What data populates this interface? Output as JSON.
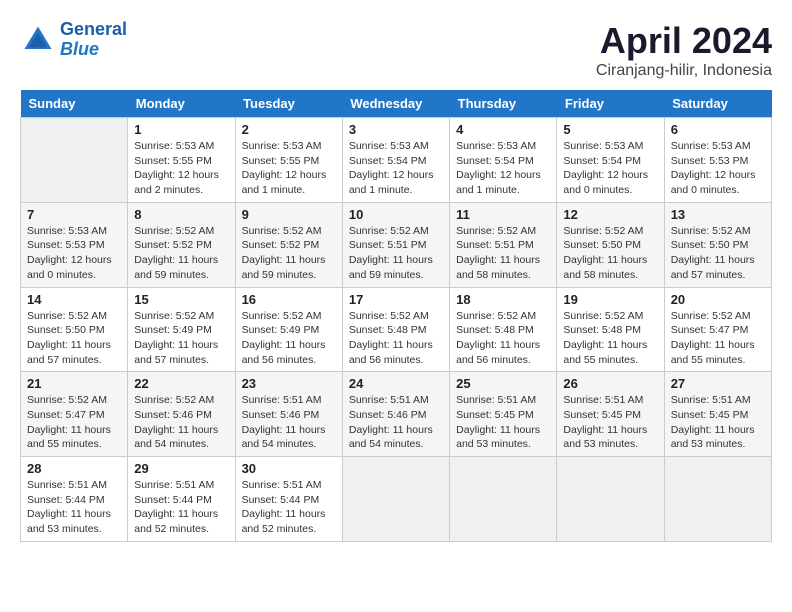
{
  "header": {
    "logo_line1": "General",
    "logo_line2": "Blue",
    "title": "April 2024",
    "subtitle": "Ciranjang-hilir, Indonesia"
  },
  "calendar": {
    "weekdays": [
      "Sunday",
      "Monday",
      "Tuesday",
      "Wednesday",
      "Thursday",
      "Friday",
      "Saturday"
    ],
    "weeks": [
      [
        {
          "day": "",
          "info": ""
        },
        {
          "day": "1",
          "info": "Sunrise: 5:53 AM\nSunset: 5:55 PM\nDaylight: 12 hours\nand 2 minutes."
        },
        {
          "day": "2",
          "info": "Sunrise: 5:53 AM\nSunset: 5:55 PM\nDaylight: 12 hours\nand 1 minute."
        },
        {
          "day": "3",
          "info": "Sunrise: 5:53 AM\nSunset: 5:54 PM\nDaylight: 12 hours\nand 1 minute."
        },
        {
          "day": "4",
          "info": "Sunrise: 5:53 AM\nSunset: 5:54 PM\nDaylight: 12 hours\nand 1 minute."
        },
        {
          "day": "5",
          "info": "Sunrise: 5:53 AM\nSunset: 5:54 PM\nDaylight: 12 hours\nand 0 minutes."
        },
        {
          "day": "6",
          "info": "Sunrise: 5:53 AM\nSunset: 5:53 PM\nDaylight: 12 hours\nand 0 minutes."
        }
      ],
      [
        {
          "day": "7",
          "info": "Sunrise: 5:53 AM\nSunset: 5:53 PM\nDaylight: 12 hours\nand 0 minutes."
        },
        {
          "day": "8",
          "info": "Sunrise: 5:52 AM\nSunset: 5:52 PM\nDaylight: 11 hours\nand 59 minutes."
        },
        {
          "day": "9",
          "info": "Sunrise: 5:52 AM\nSunset: 5:52 PM\nDaylight: 11 hours\nand 59 minutes."
        },
        {
          "day": "10",
          "info": "Sunrise: 5:52 AM\nSunset: 5:51 PM\nDaylight: 11 hours\nand 59 minutes."
        },
        {
          "day": "11",
          "info": "Sunrise: 5:52 AM\nSunset: 5:51 PM\nDaylight: 11 hours\nand 58 minutes."
        },
        {
          "day": "12",
          "info": "Sunrise: 5:52 AM\nSunset: 5:50 PM\nDaylight: 11 hours\nand 58 minutes."
        },
        {
          "day": "13",
          "info": "Sunrise: 5:52 AM\nSunset: 5:50 PM\nDaylight: 11 hours\nand 57 minutes."
        }
      ],
      [
        {
          "day": "14",
          "info": "Sunrise: 5:52 AM\nSunset: 5:50 PM\nDaylight: 11 hours\nand 57 minutes."
        },
        {
          "day": "15",
          "info": "Sunrise: 5:52 AM\nSunset: 5:49 PM\nDaylight: 11 hours\nand 57 minutes."
        },
        {
          "day": "16",
          "info": "Sunrise: 5:52 AM\nSunset: 5:49 PM\nDaylight: 11 hours\nand 56 minutes."
        },
        {
          "day": "17",
          "info": "Sunrise: 5:52 AM\nSunset: 5:48 PM\nDaylight: 11 hours\nand 56 minutes."
        },
        {
          "day": "18",
          "info": "Sunrise: 5:52 AM\nSunset: 5:48 PM\nDaylight: 11 hours\nand 56 minutes."
        },
        {
          "day": "19",
          "info": "Sunrise: 5:52 AM\nSunset: 5:48 PM\nDaylight: 11 hours\nand 55 minutes."
        },
        {
          "day": "20",
          "info": "Sunrise: 5:52 AM\nSunset: 5:47 PM\nDaylight: 11 hours\nand 55 minutes."
        }
      ],
      [
        {
          "day": "21",
          "info": "Sunrise: 5:52 AM\nSunset: 5:47 PM\nDaylight: 11 hours\nand 55 minutes."
        },
        {
          "day": "22",
          "info": "Sunrise: 5:52 AM\nSunset: 5:46 PM\nDaylight: 11 hours\nand 54 minutes."
        },
        {
          "day": "23",
          "info": "Sunrise: 5:51 AM\nSunset: 5:46 PM\nDaylight: 11 hours\nand 54 minutes."
        },
        {
          "day": "24",
          "info": "Sunrise: 5:51 AM\nSunset: 5:46 PM\nDaylight: 11 hours\nand 54 minutes."
        },
        {
          "day": "25",
          "info": "Sunrise: 5:51 AM\nSunset: 5:45 PM\nDaylight: 11 hours\nand 53 minutes."
        },
        {
          "day": "26",
          "info": "Sunrise: 5:51 AM\nSunset: 5:45 PM\nDaylight: 11 hours\nand 53 minutes."
        },
        {
          "day": "27",
          "info": "Sunrise: 5:51 AM\nSunset: 5:45 PM\nDaylight: 11 hours\nand 53 minutes."
        }
      ],
      [
        {
          "day": "28",
          "info": "Sunrise: 5:51 AM\nSunset: 5:44 PM\nDaylight: 11 hours\nand 53 minutes."
        },
        {
          "day": "29",
          "info": "Sunrise: 5:51 AM\nSunset: 5:44 PM\nDaylight: 11 hours\nand 52 minutes."
        },
        {
          "day": "30",
          "info": "Sunrise: 5:51 AM\nSunset: 5:44 PM\nDaylight: 11 hours\nand 52 minutes."
        },
        {
          "day": "",
          "info": ""
        },
        {
          "day": "",
          "info": ""
        },
        {
          "day": "",
          "info": ""
        },
        {
          "day": "",
          "info": ""
        }
      ]
    ]
  }
}
